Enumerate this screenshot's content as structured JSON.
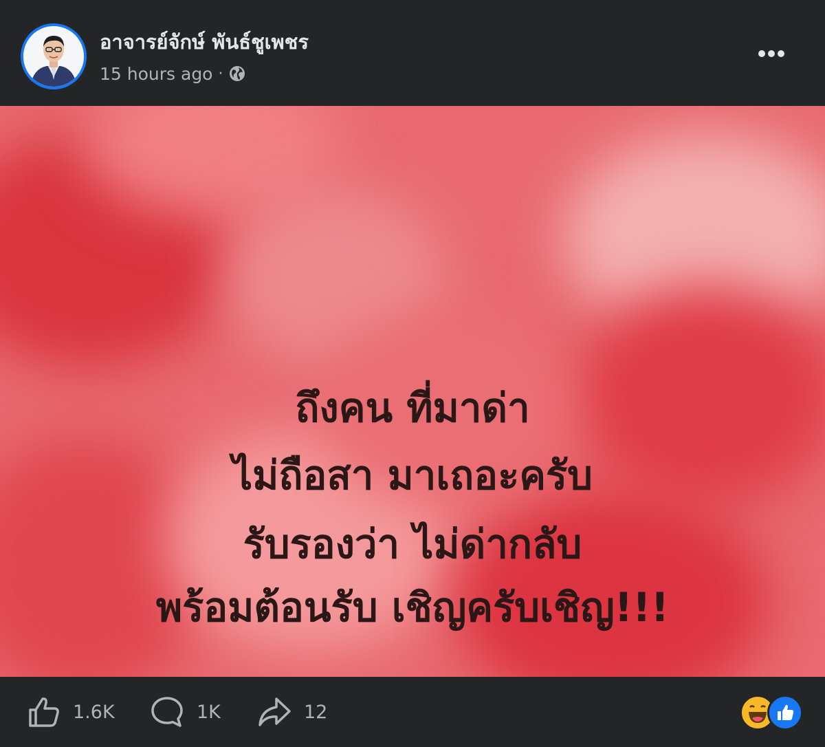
{
  "post": {
    "author_name": "อาจารย์จักษ์ พันธ์ชูเพชร",
    "timestamp": "15 hours ago",
    "separator": "·",
    "audience_icon": "globe-icon",
    "more_icon": "more-options-icon"
  },
  "image": {
    "lines": [
      "ถึงคน ที่มาด่า",
      "ไม่ถือสา มาเถอะครับ",
      "รับรองว่า ไม่ด่ากลับ",
      "พร้อมต้อนรับ เชิญครับเชิญ!!!"
    ],
    "background_color": "#e86a70",
    "text_color": "#2c1717"
  },
  "footer": {
    "like_count": "1.6K",
    "comment_count": "1K",
    "share_count": "12",
    "like_icon": "thumbs-up-icon",
    "comment_icon": "comment-icon",
    "share_icon": "share-icon",
    "reaction_icons": [
      "haha-reaction-icon",
      "like-reaction-icon"
    ]
  },
  "colors": {
    "background": "#242526",
    "text_primary": "#e4e6eb",
    "text_secondary": "#b0b3b8",
    "accent": "#1877f2"
  }
}
